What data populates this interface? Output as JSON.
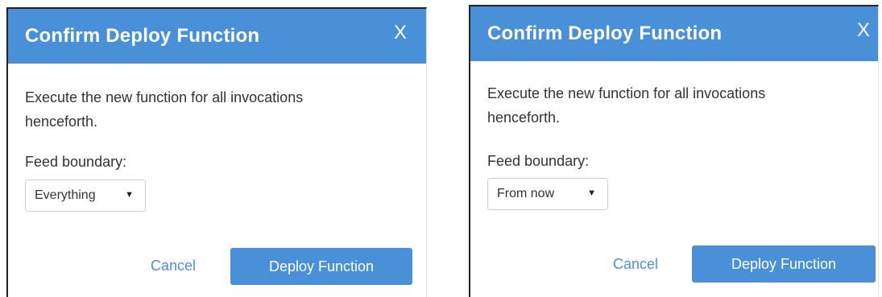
{
  "dialogs": [
    {
      "title": "Confirm Deploy Function",
      "close_label": "X",
      "message_line1": "Execute the new function for all invocations",
      "message_line2": "henceforth.",
      "field_label": "Feed boundary:",
      "select_value": "Everything",
      "caret": "▼",
      "cancel_label": "Cancel",
      "confirm_label": "Deploy Function"
    },
    {
      "title": "Confirm Deploy Function",
      "close_label": "X",
      "message_line1": "Execute the new function for all invocations",
      "message_line2": "henceforth.",
      "field_label": "Feed boundary:",
      "select_value": "From now",
      "caret": "▼",
      "cancel_label": "Cancel",
      "confirm_label": "Deploy Function"
    }
  ],
  "colors": {
    "header_bg": "#4a90d9",
    "primary_button": "#4a90d9",
    "link": "#4a90d9",
    "text": "#333333"
  }
}
